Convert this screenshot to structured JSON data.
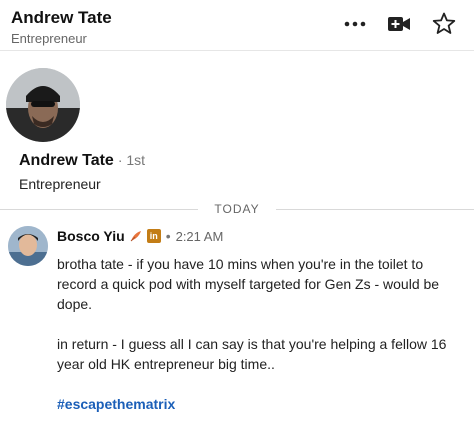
{
  "header": {
    "name": "Andrew Tate",
    "subtitle": "Entrepreneur",
    "icons": [
      "more-icon",
      "video-call-icon",
      "star-icon"
    ]
  },
  "profile": {
    "name": "Andrew Tate",
    "degree": "· 1st",
    "headline": "Entrepreneur"
  },
  "conversation": {
    "date_divider": "TODAY",
    "messages": [
      {
        "sender": "Bosco Yiu",
        "badge_icons": [
          "quill-icon",
          "linkedin-premium-icon"
        ],
        "premium_badge_text": "in",
        "separator": "•",
        "time": "2:21 AM",
        "paragraph_1": "brotha tate - if you have 10 mins when you're in the toilet to record a quick pod with myself targeted for Gen Zs - would be dope.",
        "paragraph_2": "in return - I guess all I can say is that you're helping a fellow 16 year old HK entrepreneur big time..",
        "hashtag": "#escapethematrix"
      }
    ]
  },
  "colors": {
    "hashtag": "#1b5fb8",
    "premium_badge": "#c37d16"
  }
}
